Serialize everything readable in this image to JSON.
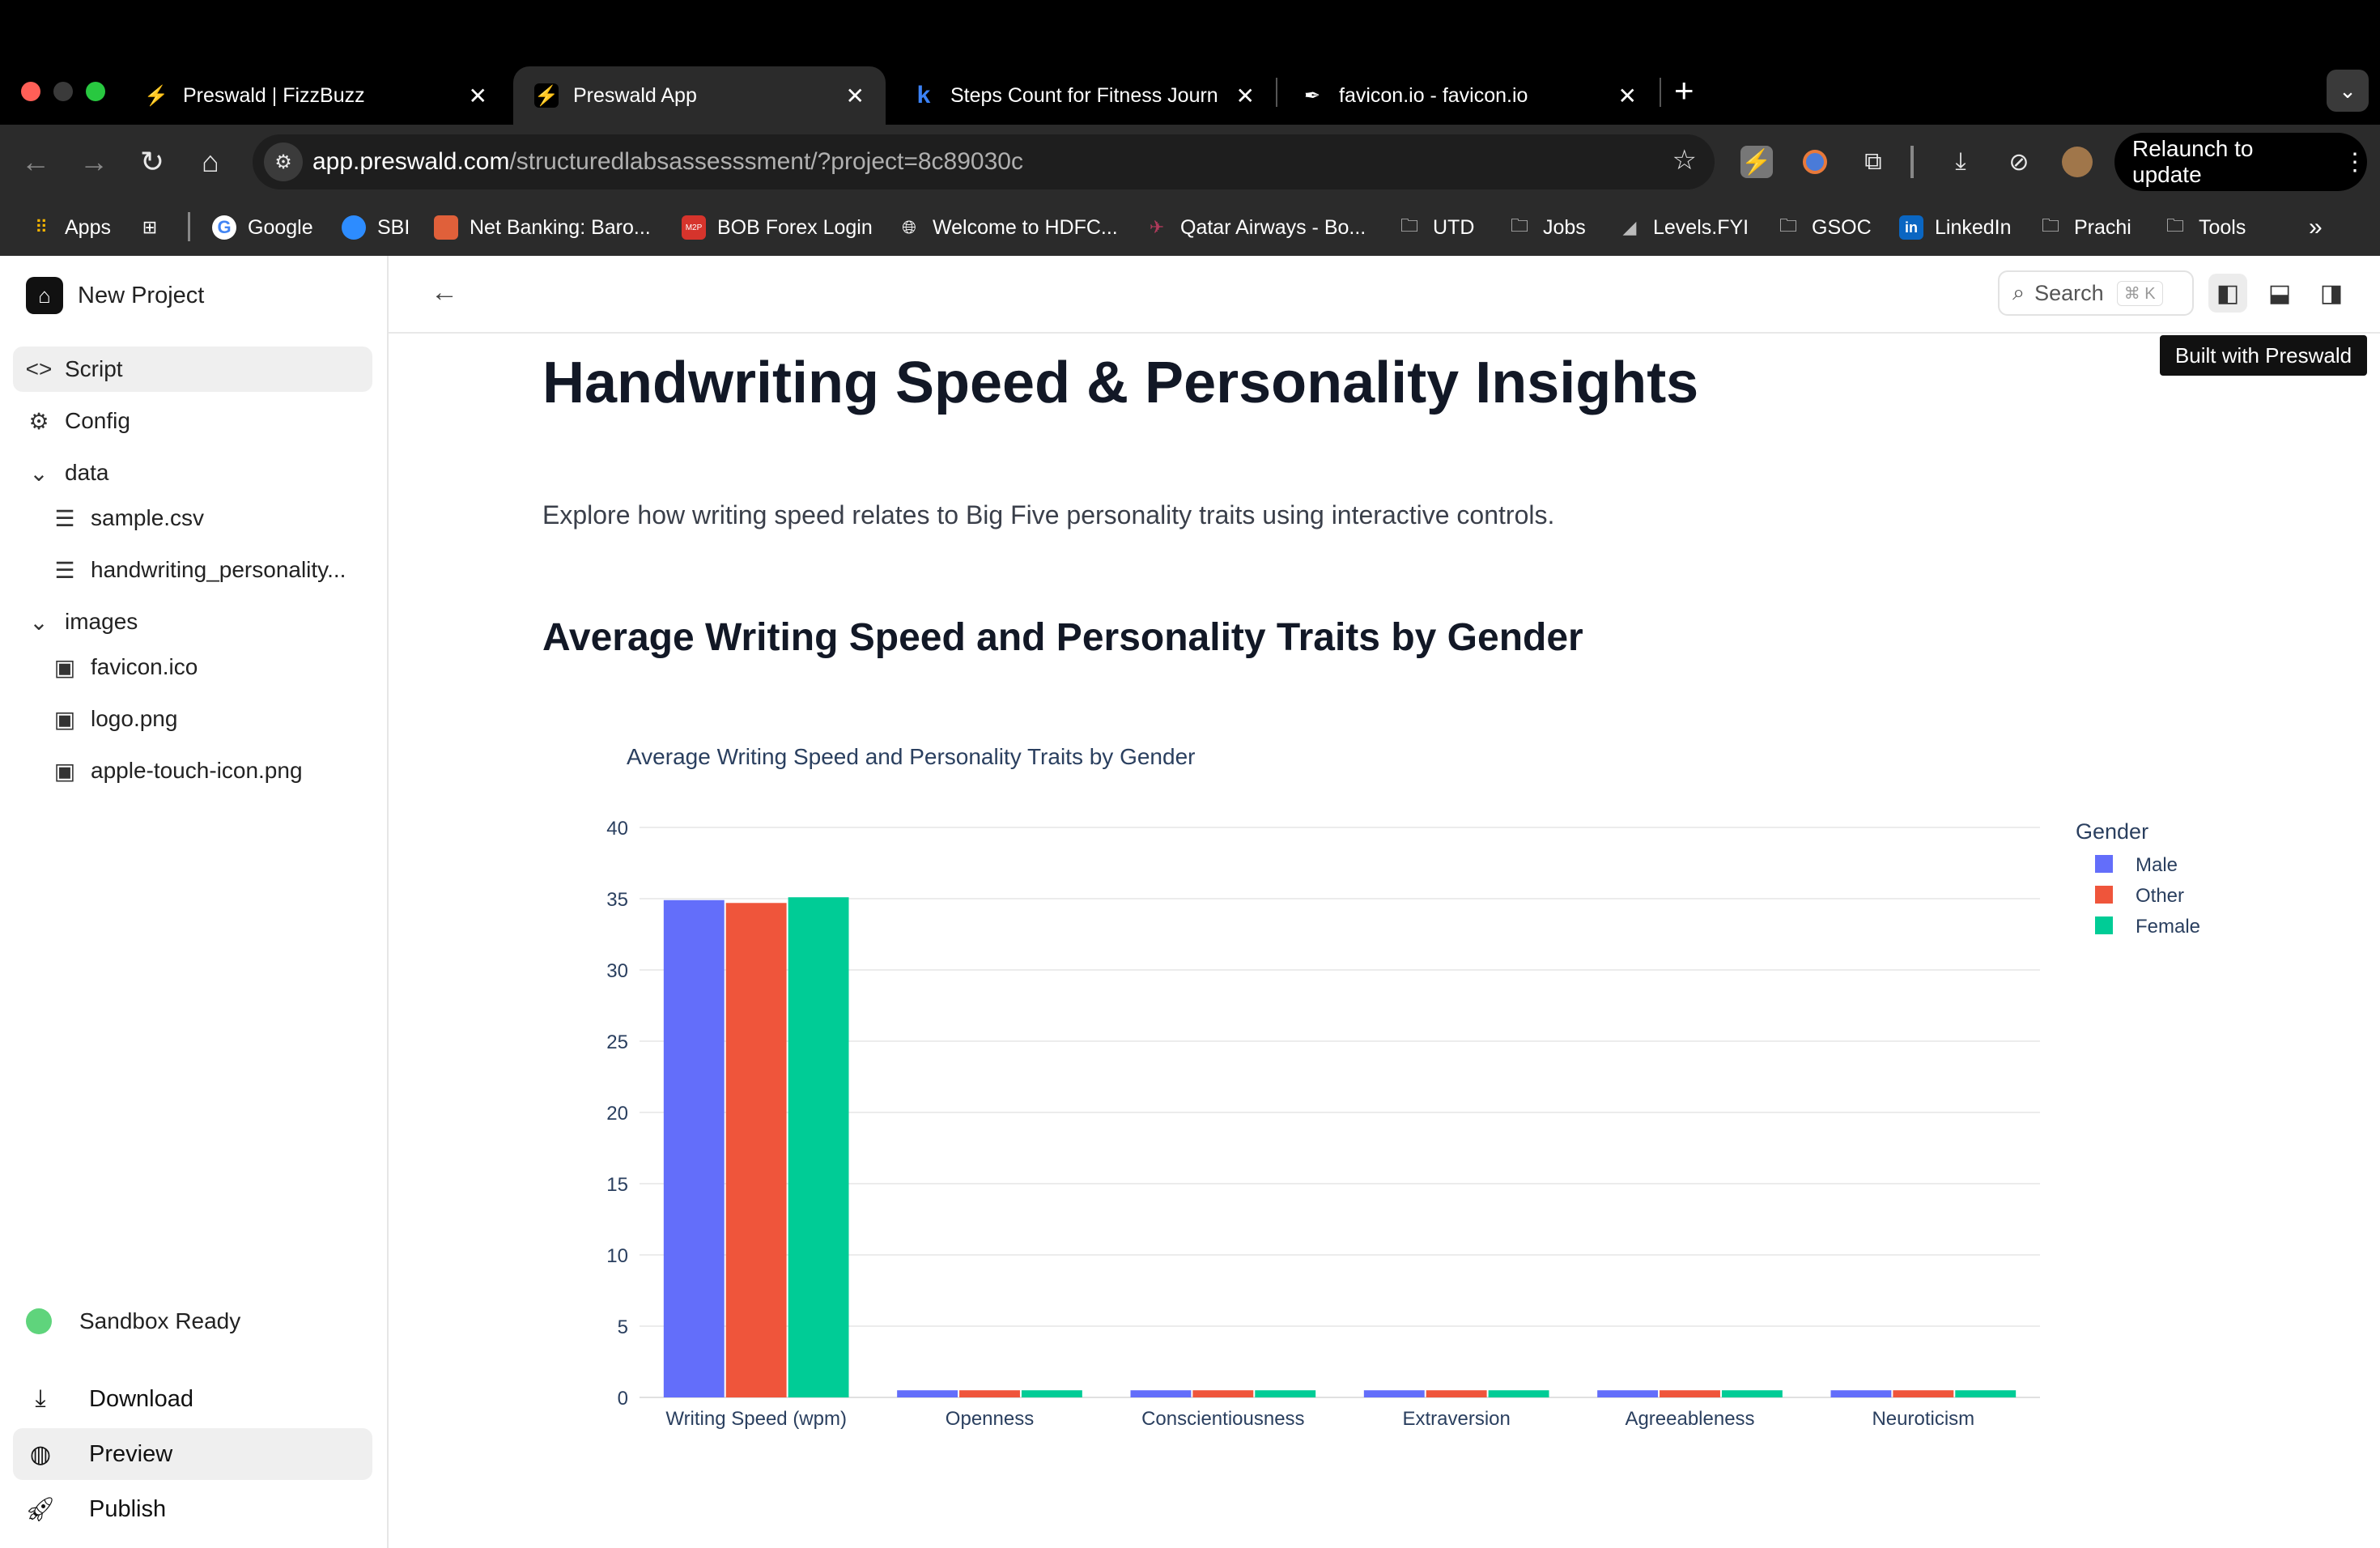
{
  "browser": {
    "tabs": [
      {
        "title": "Preswald | FizzBuzz",
        "icon": "preswald-icon",
        "active": false
      },
      {
        "title": "Preswald App",
        "icon": "preswald-icon",
        "active": true
      },
      {
        "title": "Steps Count for Fitness Journ",
        "icon": "k-icon",
        "active": false
      },
      {
        "title": "favicon.io - favicon.io",
        "icon": "pen-icon",
        "active": false
      }
    ],
    "url_host": "app.preswald.com",
    "url_path": "/structuredlabsassesssment/?project=8c89030c",
    "relaunch_label": "Relaunch to update",
    "bookmarks": [
      {
        "label": "Apps",
        "icon": "apps-grid-icon"
      },
      {
        "label": "",
        "icon": "grid-icon"
      },
      {
        "label": "Google",
        "icon": "google-icon"
      },
      {
        "label": "SBI",
        "icon": "sbi-icon"
      },
      {
        "label": "Net Banking: Baro...",
        "icon": "bank-icon"
      },
      {
        "label": "BOB Forex Login",
        "icon": "m2p-icon"
      },
      {
        "label": "Welcome to HDFC...",
        "icon": "globe-icon"
      },
      {
        "label": "Qatar Airways - Bo...",
        "icon": "airline-icon"
      },
      {
        "label": "UTD",
        "icon": "folder-icon"
      },
      {
        "label": "Jobs",
        "icon": "folder-icon"
      },
      {
        "label": "Levels.FYI",
        "icon": "levels-icon"
      },
      {
        "label": "GSOC",
        "icon": "folder-icon"
      },
      {
        "label": "LinkedIn",
        "icon": "linkedin-icon"
      },
      {
        "label": "Prachi",
        "icon": "folder-icon"
      },
      {
        "label": "Tools",
        "icon": "folder-icon"
      }
    ]
  },
  "sidebar": {
    "project_name": "New Project",
    "items": [
      {
        "label": "Script",
        "icon": "code-icon"
      },
      {
        "label": "Config",
        "icon": "gear-icon"
      },
      {
        "label": "data",
        "icon": "chevron-down-icon"
      },
      {
        "label": "sample.csv",
        "icon": "database-icon"
      },
      {
        "label": "handwriting_personality...",
        "icon": "database-icon"
      },
      {
        "label": "images",
        "icon": "chevron-down-icon"
      },
      {
        "label": "favicon.ico",
        "icon": "image-icon"
      },
      {
        "label": "logo.png",
        "icon": "image-icon"
      },
      {
        "label": "apple-touch-icon.png",
        "icon": "image-icon"
      }
    ],
    "status": "Sandbox Ready",
    "bottom": [
      {
        "label": "Download",
        "icon": "download-icon"
      },
      {
        "label": "Preview",
        "icon": "globe-icon"
      },
      {
        "label": "Publish",
        "icon": "rocket-icon"
      }
    ]
  },
  "topbar": {
    "search_label": "Search",
    "search_shortcut": "⌘ K",
    "tooltip": "Built with Preswald"
  },
  "content": {
    "title": "Handwriting Speed & Personality Insights",
    "description": "Explore how writing speed relates to Big Five personality traits using interactive controls.",
    "section_title": "Average Writing Speed and Personality Traits by Gender"
  },
  "chart_data": {
    "type": "bar",
    "title": "Average Writing Speed and Personality Traits by Gender",
    "categories": [
      "Writing Speed (wpm)",
      "Openness",
      "Conscientiousness",
      "Extraversion",
      "Agreeableness",
      "Neuroticism"
    ],
    "series": [
      {
        "name": "Male",
        "color": "#636efa",
        "values": [
          34.9,
          0.5,
          0.5,
          0.5,
          0.5,
          0.5
        ]
      },
      {
        "name": "Other",
        "color": "#ef553b",
        "values": [
          34.7,
          0.5,
          0.5,
          0.5,
          0.5,
          0.5
        ]
      },
      {
        "name": "Female",
        "color": "#00cc96",
        "values": [
          35.1,
          0.5,
          0.5,
          0.5,
          0.5,
          0.5
        ]
      }
    ],
    "legend_title": "Gender",
    "ylim": [
      0,
      40
    ],
    "yticks": [
      0,
      5,
      10,
      15,
      20,
      25,
      30,
      35,
      40
    ],
    "grid": true,
    "legend_position": "right"
  }
}
